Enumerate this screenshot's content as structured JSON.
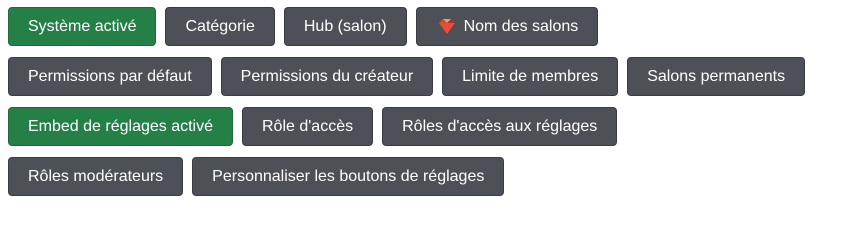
{
  "rows": [
    {
      "buttons": [
        {
          "label": "Système activé",
          "style": "green"
        },
        {
          "label": "Catégorie",
          "style": "grey"
        },
        {
          "label": "Hub (salon)",
          "style": "grey"
        },
        {
          "label": "Nom des salons",
          "style": "grey",
          "icon": "gem-emoji-icon"
        }
      ]
    },
    {
      "buttons": [
        {
          "label": "Permissions par défaut",
          "style": "grey"
        },
        {
          "label": "Permissions du créateur",
          "style": "grey"
        },
        {
          "label": "Limite de membres",
          "style": "grey"
        },
        {
          "label": "Salons permanents",
          "style": "grey"
        }
      ]
    },
    {
      "buttons": [
        {
          "label": "Embed de réglages activé",
          "style": "green"
        },
        {
          "label": "Rôle d'accès",
          "style": "grey"
        },
        {
          "label": "Rôles d'accès aux réglages",
          "style": "grey"
        }
      ]
    },
    {
      "buttons": [
        {
          "label": "Rôles modérateurs",
          "style": "grey"
        },
        {
          "label": "Personnaliser les boutons de réglages",
          "style": "grey"
        }
      ]
    }
  ],
  "colors": {
    "grey_button": "#4e5058",
    "green_button": "#248046",
    "text": "#ffffff"
  }
}
